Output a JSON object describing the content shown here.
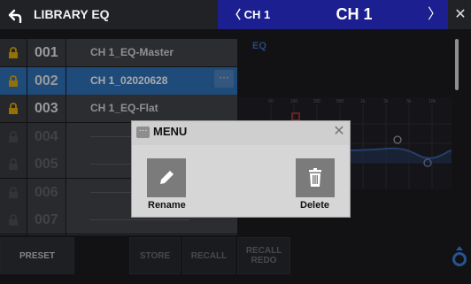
{
  "header": {
    "title": "LIBRARY EQ",
    "ch_prev": "〈 CH 1",
    "ch_title": "CH 1",
    "ch_next": "〉",
    "close": "✕"
  },
  "library": {
    "items": [
      {
        "number": "001",
        "name": "CH 1_EQ-Master",
        "locked": true
      },
      {
        "number": "002",
        "name": "CH 1_02020628",
        "locked": true,
        "selected": true
      },
      {
        "number": "003",
        "name": "CH 1_EQ-Flat",
        "locked": true
      },
      {
        "number": "004",
        "name": "",
        "locked": false
      },
      {
        "number": "005",
        "name": "",
        "locked": false
      },
      {
        "number": "006",
        "name": "",
        "locked": false
      },
      {
        "number": "007",
        "name": "",
        "locked": false
      },
      {
        "number": "008",
        "name": "",
        "locked": false
      }
    ],
    "more_label": "···"
  },
  "eq_panel": {
    "label": "EQ",
    "freq_ticks": [
      "50",
      "100",
      "200",
      "500",
      "1k",
      "2k",
      "5k",
      "10k"
    ]
  },
  "bottom": {
    "preset": "PRESET",
    "store": "STORE",
    "recall": "RECALL",
    "recall_redo": "RECALL REDO"
  },
  "dialog": {
    "icon_label": "···",
    "title": "MENU",
    "close": "✕",
    "rename": "Rename",
    "delete": "Delete"
  },
  "colors": {
    "header_blue": "#1b1f8f",
    "selected_row": "#2b6fb5",
    "accent_blue": "#3c67b3"
  }
}
